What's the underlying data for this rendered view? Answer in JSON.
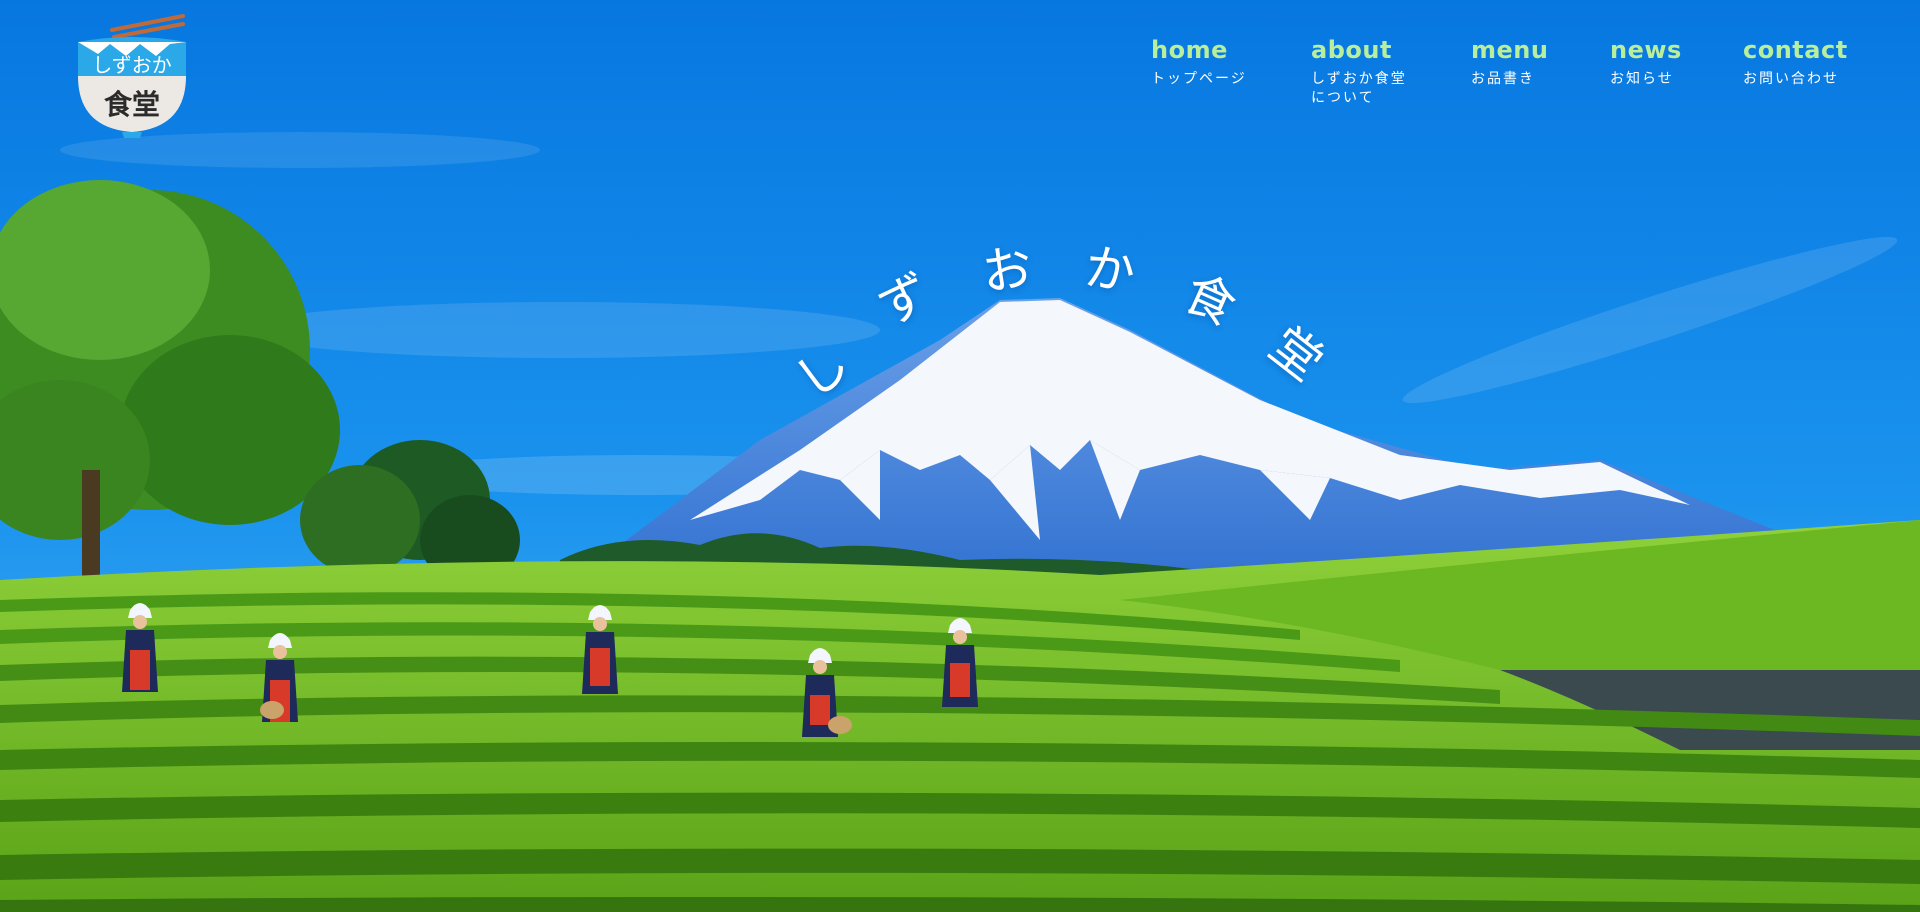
{
  "logo": {
    "top_text": "しずおか",
    "bottom_text": "食堂"
  },
  "nav": {
    "items": [
      {
        "en": "home",
        "ja": "トップページ"
      },
      {
        "en": "about",
        "ja": "しずおか食堂\nについて"
      },
      {
        "en": "menu",
        "ja": "お品書き"
      },
      {
        "en": "news",
        "ja": "お知らせ"
      },
      {
        "en": "contact",
        "ja": "お問い合わせ"
      }
    ]
  },
  "hero": {
    "title_chars": [
      "し",
      "ず",
      "お",
      "か",
      "食",
      "堂"
    ]
  },
  "colors": {
    "nav_accent": "#b9ee9d",
    "sky": "#0a7fe0",
    "tea_green": "#7cc52a"
  }
}
